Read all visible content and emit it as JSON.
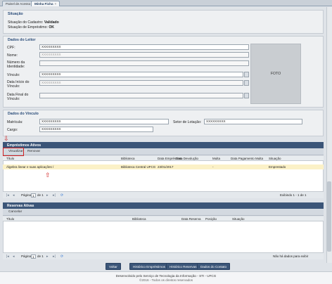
{
  "tabs": [
    {
      "label": "Painel de Acesso"
    },
    {
      "label": "Minha Ficha",
      "close": "×"
    }
  ],
  "situacao": {
    "title": "Situação",
    "cadastro_label": "Situação do Cadastro:",
    "cadastro_value": "Validado",
    "emprestimo_label": "Situação de Empréstimo:",
    "emprestimo_value": "OK"
  },
  "leitor": {
    "title": "Dados do Leitor",
    "cpf_label": "CPF:",
    "cpf_value": "XXXXXXXXX",
    "nome_label": "Nome:",
    "nome_value": "XXXXXXXXX",
    "identidade_label": "Número da Identidade:",
    "identidade_value": "",
    "vinculo_label": "Vínculo:",
    "vinculo_value": "XXXXXXXXX",
    "data_inicio_label": "Data Início do Vínculo:",
    "data_inicio_value": "XXXXXXXXX",
    "data_final_label": "Data Final do Vínculo:",
    "data_final_value": "",
    "foto_label": "FOTO"
  },
  "vinculo": {
    "title": "Dados do Vínculo",
    "matricula_label": "Matrícula:",
    "matricula_value": "XXXXXXXXX",
    "setor_label": "Setor de Lotação:",
    "setor_value": "XXXXXXXXX",
    "cargo_label": "Cargo:",
    "cargo_value": "XXXXXXXXX"
  },
  "emprestimos": {
    "title": "Empréstimos Ativos",
    "visualizar": "Visualizar",
    "renovar": "Renovar",
    "columns": [
      "Título",
      "Biblioteca",
      "Data Empréstimo",
      "Data Devolução",
      "Multa",
      "Data Pagamento Multa",
      "Situação"
    ],
    "row": {
      "titulo": "Álgebra linear e suas aplicações /",
      "biblioteca": "Biblioteca Central UFCG",
      "data_emprestimo": "23/01/2017",
      "data_devolucao": "",
      "multa": "-",
      "data_pagamento": "",
      "situacao": "Emprestado"
    },
    "pager": {
      "pagina": "Página",
      "page": "1",
      "de": "de 1",
      "exibindo": "Exibindo 1 - 1 de 1"
    }
  },
  "reservas": {
    "title": "Reservas Ativas",
    "cancelar": "Cancelar",
    "columns": [
      "Título",
      "Biblioteca",
      "Data Reserva",
      "Posição",
      "Situação"
    ],
    "pager": {
      "pagina": "Página",
      "page": "1",
      "de": "de 1",
      "nodata": "Não há dados para exibir"
    }
  },
  "buttons": {
    "voltar": "Voltar",
    "historico_emprestimos": "Histórico Empréstimos",
    "historico_reservas": "Histórico Reservas",
    "dados_contato": "Dados do Contato"
  },
  "footer": {
    "line1": "Desenvolvido pelo Serviço de Tecnologia da Informação - STI - UFCG",
    "line2": "©2016 - Todos os direitos reservados"
  },
  "colors": {
    "header_blue": "#3b5578",
    "highlight_row": "#fbf1c7",
    "annotation_red": "#d21f1f"
  },
  "icons": [
    "close-icon",
    "lookup-icon",
    "pager-first-icon",
    "pager-prev-icon",
    "pager-next-icon",
    "pager-last-icon",
    "refresh-icon",
    "arrow-annotation-icon"
  ]
}
